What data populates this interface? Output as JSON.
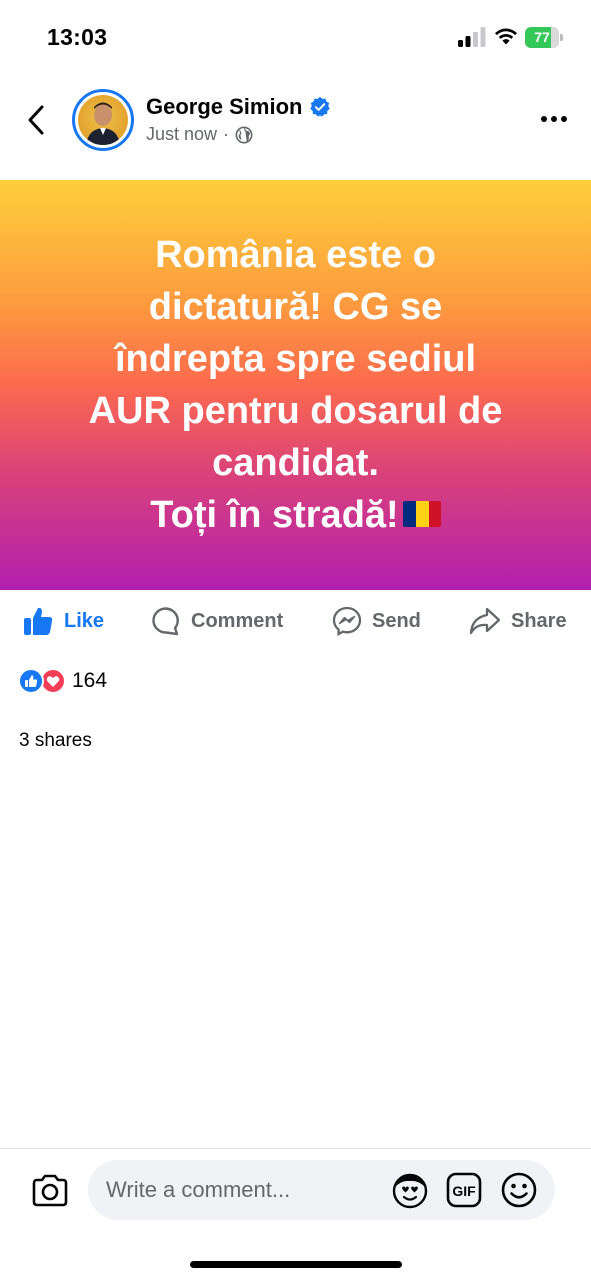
{
  "status_bar": {
    "time": "13:03",
    "battery": {
      "percent": 77,
      "label": "77",
      "color": "#34c759"
    },
    "signal_bars_active": 2,
    "icons": [
      "signal-icon",
      "wifi-icon",
      "battery-icon"
    ]
  },
  "post": {
    "author": {
      "name": "George Simion",
      "verified": true
    },
    "meta": {
      "time": "Just now",
      "separator": "·",
      "audience_icon": "globe-icon"
    },
    "text_lines": [
      "România este o",
      "dictatură! CG se",
      "îndrepta spre sediul",
      "AUR pentru dosarul de",
      "candidat.",
      "Toți în stradă!"
    ],
    "flag": {
      "name": "romania-flag-icon",
      "colors": [
        "#002b7f",
        "#fcd116",
        "#ce1126"
      ]
    },
    "banner_gradient": [
      "#fdcf3b",
      "#fd9b3e",
      "#fc6a4e",
      "#d9417a",
      "#b21fb0"
    ]
  },
  "actions": {
    "like": "Like",
    "comment": "Comment",
    "send": "Send",
    "share": "Share"
  },
  "reactions": {
    "types": [
      "like",
      "love"
    ],
    "count": "164"
  },
  "shares": "3 shares",
  "comment_bar": {
    "placeholder": "Write a comment...",
    "gif_label": "GIF",
    "icons": [
      "camera-icon",
      "avatar-sticker-icon",
      "gif-icon",
      "emoji-icon"
    ]
  },
  "colors": {
    "accent": "#1877f2",
    "love": "#f33e58",
    "secondary_text": "#65676b"
  }
}
